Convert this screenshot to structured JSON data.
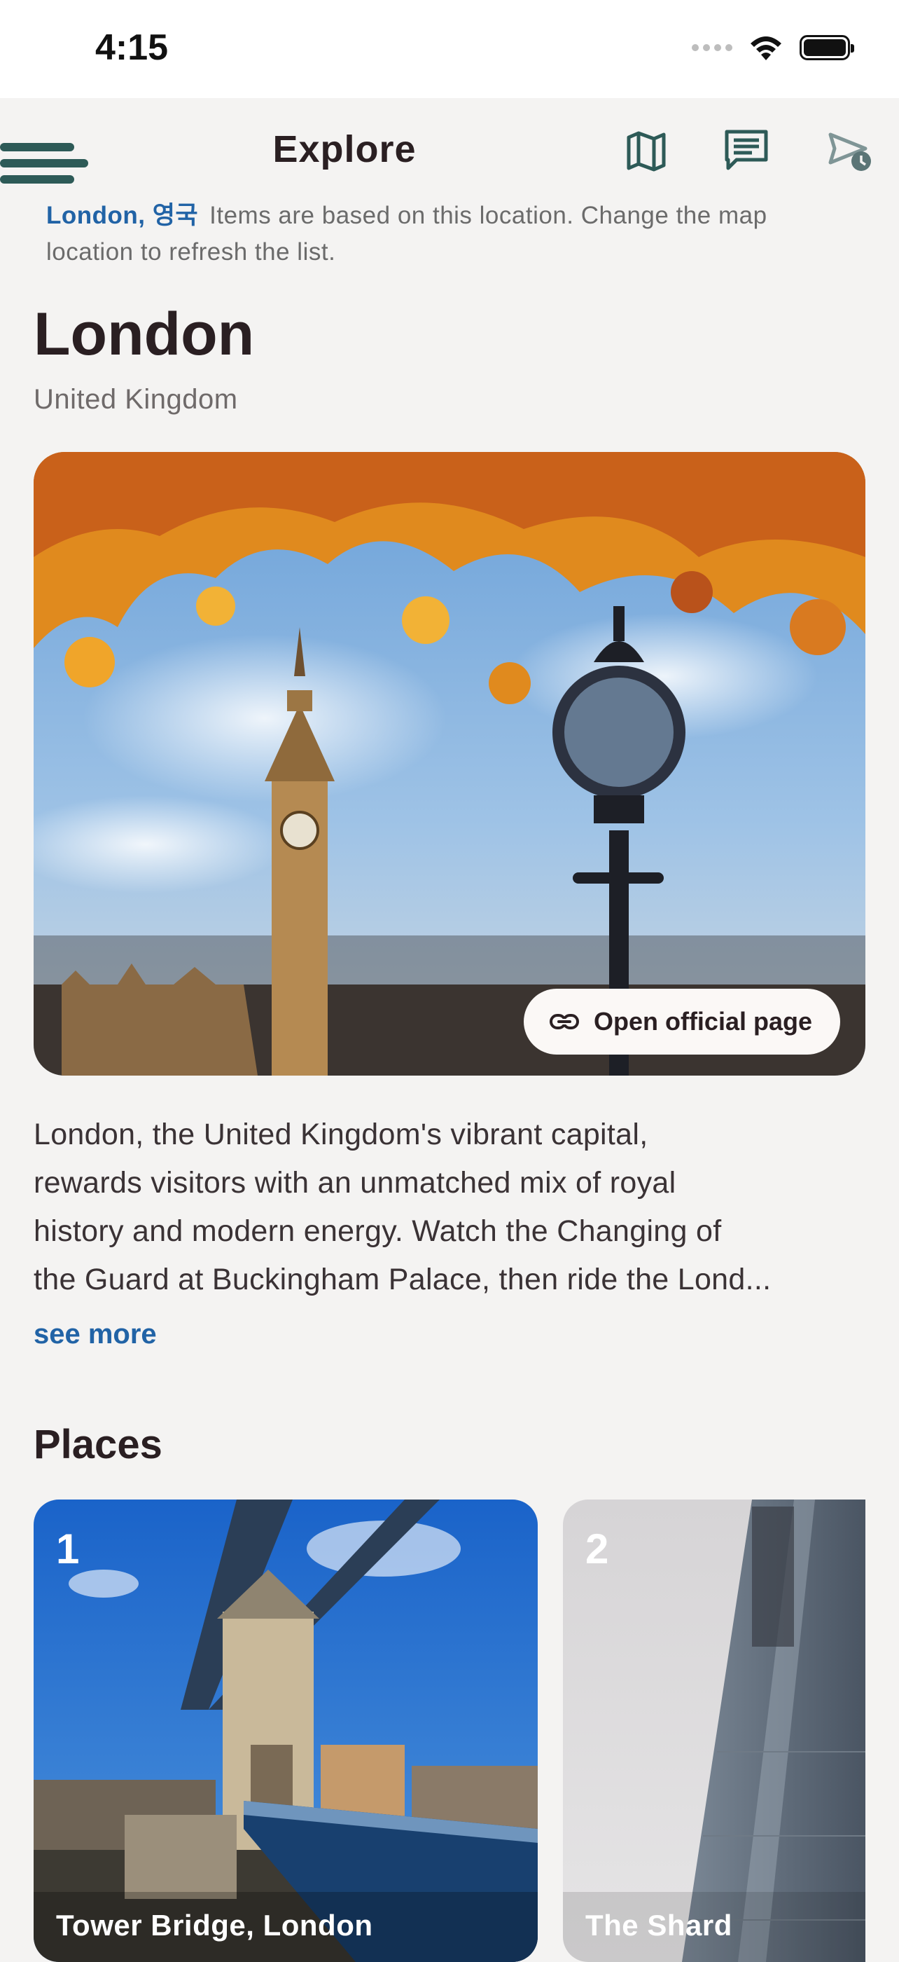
{
  "status_bar": {
    "time": "4:15"
  },
  "app_bar": {
    "title": "Explore",
    "icons": [
      "menu-icon",
      "map-icon",
      "chat-icon",
      "send-schedule-icon"
    ]
  },
  "location_note": {
    "location": "London, 영국",
    "text": "Items are based on this location. Change the map location to refresh the list."
  },
  "city": {
    "name": "London",
    "country": "United Kingdom",
    "official_button": "Open official page",
    "description_lines": [
      "London, the United Kingdom's vibrant capital,",
      "rewards visitors with an unmatched mix of royal",
      "history and modern energy. Watch the Changing of",
      "the Guard at Buckingham Palace, then ride the Lond..."
    ],
    "see_more": "see more"
  },
  "places": {
    "title": "Places",
    "items": [
      {
        "number": "1",
        "name": "Tower Bridge, London"
      },
      {
        "number": "2",
        "name": "The Shard"
      }
    ]
  },
  "colors": {
    "accent": "#2163a6",
    "icon_teal": "#2d5a57",
    "background": "#f4f3f2",
    "heading": "#2a1f22"
  }
}
